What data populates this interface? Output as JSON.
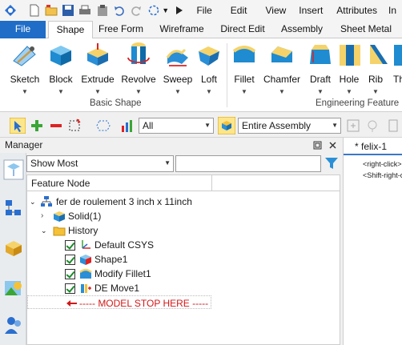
{
  "menubar": {
    "items": [
      "File",
      "Edit",
      "View",
      "Insert",
      "Attributes",
      "In"
    ]
  },
  "ribbon_tabs": [
    "File",
    "Shape",
    "Free Form",
    "Wireframe",
    "Direct Edit",
    "Assembly",
    "Sheet Metal"
  ],
  "ribbon": {
    "basic_shape": {
      "label": "Basic Shape",
      "buttons": [
        "Sketch",
        "Block",
        "Extrude",
        "Revolve",
        "Sweep",
        "Loft"
      ]
    },
    "engineering_feature": {
      "label": "Engineering Feature",
      "buttons": [
        "Fillet",
        "Chamfer",
        "Draft",
        "Hole",
        "Rib",
        "Th"
      ]
    }
  },
  "toolbar": {
    "filter_value": "All",
    "scope_value": "Entire Assembly"
  },
  "manager": {
    "title": "Manager",
    "show_value": "Show Most",
    "search_value": "",
    "column_header": "Feature Node",
    "tree": {
      "root": "fer de roulement 3 inch x 11inch",
      "solid": "Solid(1)",
      "history": "History",
      "items": [
        "Default CSYS",
        "Shape1",
        "Modify Fillet1",
        "DE Move1"
      ],
      "stop_marker": "----- MODEL STOP HERE -----"
    }
  },
  "document": {
    "tab_label": "* felix-1",
    "hints": [
      "<right-click>",
      "<Shift-right-c"
    ]
  },
  "colors": {
    "accent": "#1f6dc7",
    "stop": "#d11818",
    "check": "#1b8a2a"
  }
}
